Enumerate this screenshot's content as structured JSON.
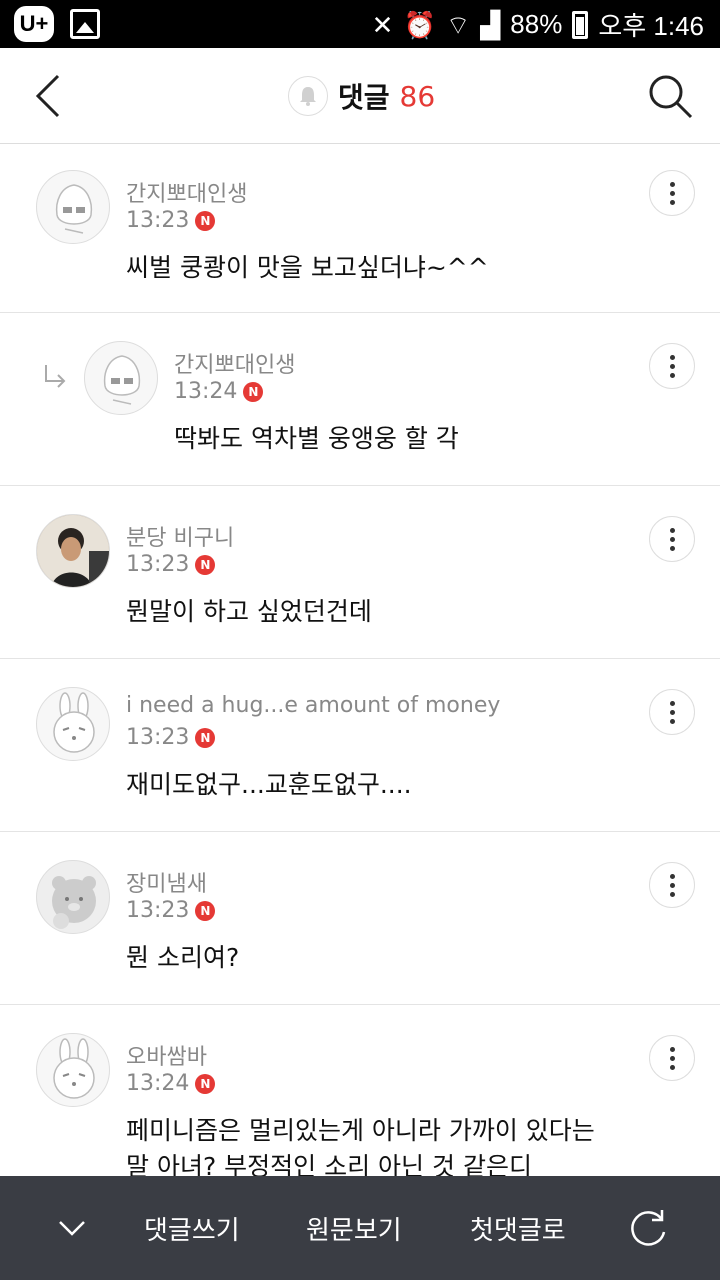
{
  "status_bar": {
    "carrier_icon": "U+",
    "battery": "88%",
    "time": "오후 1:46"
  },
  "header": {
    "title": "댓글",
    "count": "86"
  },
  "comments": [
    {
      "name": "간지뽀대인생",
      "time": "13:23",
      "badge": "N",
      "text": "씨벌 쿵쾅이 맛을 보고싶더냐~^^"
    },
    {
      "name": "간지뽀대인생",
      "time": "13:24",
      "badge": "N",
      "text": "딱봐도 역차별 웅앵웅 할 각"
    },
    {
      "name": "분당 비구니",
      "time": "13:23",
      "badge": "N",
      "text": "뭔말이 하고 싶었던건데"
    },
    {
      "name": "i need a hug...e amount of money",
      "time": "13:23",
      "badge": "N",
      "text": "재미도없구...교훈도없구...."
    },
    {
      "name": "장미냄새",
      "time": "13:23",
      "badge": "N",
      "text": "뭔 소리여?"
    },
    {
      "name": "오바쌈바",
      "time": "13:24",
      "badge": "N",
      "text_line1": "페미니즘은 멀리있는게 아니라 가까이 있다는",
      "text_line2": "말 아녀? 부정적인 소리 아닌 것 같은디"
    }
  ],
  "bottom_bar": {
    "write": "댓글쓰기",
    "original": "원문보기",
    "first": "첫댓글로"
  },
  "colors": {
    "accent": "#e53935",
    "bottom_bar": "#3a3d44"
  }
}
